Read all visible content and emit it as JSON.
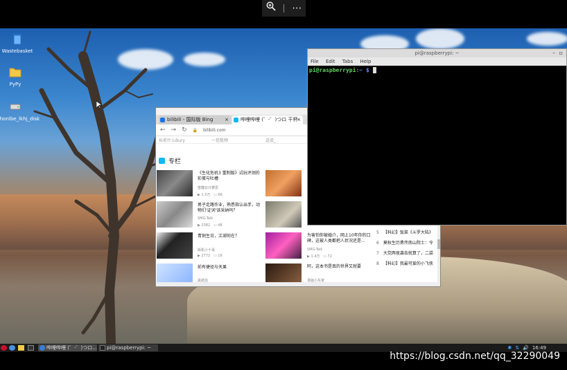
{
  "viewer": {
    "zoom_icon": "zoom-in-icon",
    "more_icon": "more-icon",
    "more_glyph": "⋯"
  },
  "desktop": {
    "icons": [
      {
        "label": "Wastebasket",
        "icon": "trash-icon"
      },
      {
        "label": "PyPy",
        "icon": "folder-icon"
      },
      {
        "label": "thonlbe_lkhj_disk",
        "icon": "drive-icon"
      }
    ]
  },
  "terminal": {
    "title": "pi@raspberrypi: ~",
    "menu": [
      "File",
      "Edit",
      "Tabs",
      "Help"
    ],
    "prompt_user": "pi@raspberrypi",
    "prompt_path": ":~ $"
  },
  "browser": {
    "window_title": "哔哩哔哩 (゜-゜)つロ 干杯~",
    "tabs": [
      {
        "label": "bilibili - 国际版 Bing",
        "color": "#1a73e8"
      },
      {
        "label": "哔哩哔哩 (゜-゜)つロ 干杯",
        "color": "#12b7f5"
      }
    ],
    "url": "bilibili.com",
    "bookmarks": [
      "长名什么Bury",
      "一括覧频",
      "话说_"
    ],
    "column_heading": "专栏",
    "articles": [
      {
        "title": "《生化危机3 重制版》试玩评测的彩蛋与吐槽",
        "author": "蜜糖云计算爱",
        "views": "1.5万",
        "comments": "66"
      },
      {
        "title": "男子走路作业，熟悉指认出手，动物们'证词'该采纳吗？",
        "author": "SMG-Talk",
        "views": "2382",
        "comments": "48"
      },
      {
        "title": "青铜生日，江湖何在？",
        "author": "街机小十哥",
        "views": "2772",
        "comments": "16"
      },
      {
        "title": "前有捷径与天果",
        "author": "黑纸伯",
        "views": "",
        "comments": ""
      }
    ],
    "side_articles": [
      {
        "title": "为害怕你被婚介，网上10年你的口碑，这被人类都把人状况还是...",
        "author": "SMG-Talk",
        "views": "1.4万",
        "comments": "72"
      },
      {
        "title": "阿，这本书是真的世界又就要",
        "author": "漫画小东家",
        "views": "",
        "comments": ""
      }
    ],
    "ranking": [
      {
        "n": "5",
        "text": "【科幻】饭菜《斗罗大陆》"
      },
      {
        "n": "6",
        "text": "莫秋生历勇传南山院士：令"
      },
      {
        "n": "7",
        "text": "大党两夜袭击就算了，二袋"
      },
      {
        "n": "8",
        "text": "【科幻】我最可爱的小飞侠"
      }
    ]
  },
  "taskbar": {
    "buttons": [
      {
        "label": "哔哩哔哩 (゜-゜)つロ...",
        "color": "#3b7cd6"
      },
      {
        "label": "pi@raspberrypi: ~",
        "color": "#222"
      }
    ],
    "tray": [
      "✱",
      "⇅",
      "🔊",
      "16:49"
    ]
  },
  "watermark": "https://blog.csdn.net/qq_32290049"
}
